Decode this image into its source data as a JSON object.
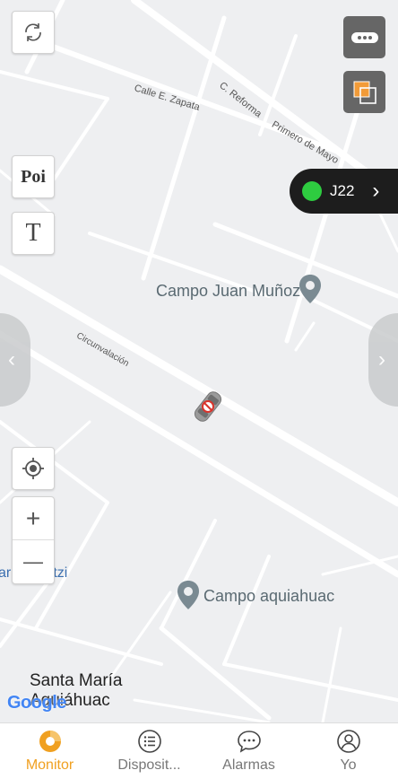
{
  "map": {
    "streets": [
      "Calle E. Zapata",
      "C. Reforma",
      "Primero de Mayo",
      "Circunvalación"
    ],
    "places": [
      {
        "name": "Campo Juan Muñoz"
      },
      {
        "name": "Campo aquiahuac"
      }
    ],
    "partial_label": "ar    acoltzi",
    "town": {
      "line1": "Santa María",
      "line2": "Aquiáhuac"
    },
    "attribution": "Google"
  },
  "controls": {
    "refresh": "refresh-icon",
    "poi_label": "Poi",
    "text_label": "T",
    "locate": "crosshair-icon",
    "zoom_in": "+",
    "zoom_out": "—",
    "more": "more-icon",
    "layers": "layers-icon"
  },
  "device": {
    "name": "J22",
    "status_color": "#2ecc40",
    "arrow": "›"
  },
  "side_tabs": {
    "left": "‹",
    "right": "›"
  },
  "tabs": [
    {
      "label": "Monitor",
      "icon": "monitor-icon",
      "active": true
    },
    {
      "label": "Disposit...",
      "icon": "list-icon",
      "active": false
    },
    {
      "label": "Alarmas",
      "icon": "chat-icon",
      "active": false
    },
    {
      "label": "Yo",
      "icon": "user-icon",
      "active": false
    }
  ],
  "colors": {
    "accent": "#f0a020",
    "pill": "#1d1d1d",
    "road": "#ffffff",
    "map_bg": "#eeeff1"
  }
}
